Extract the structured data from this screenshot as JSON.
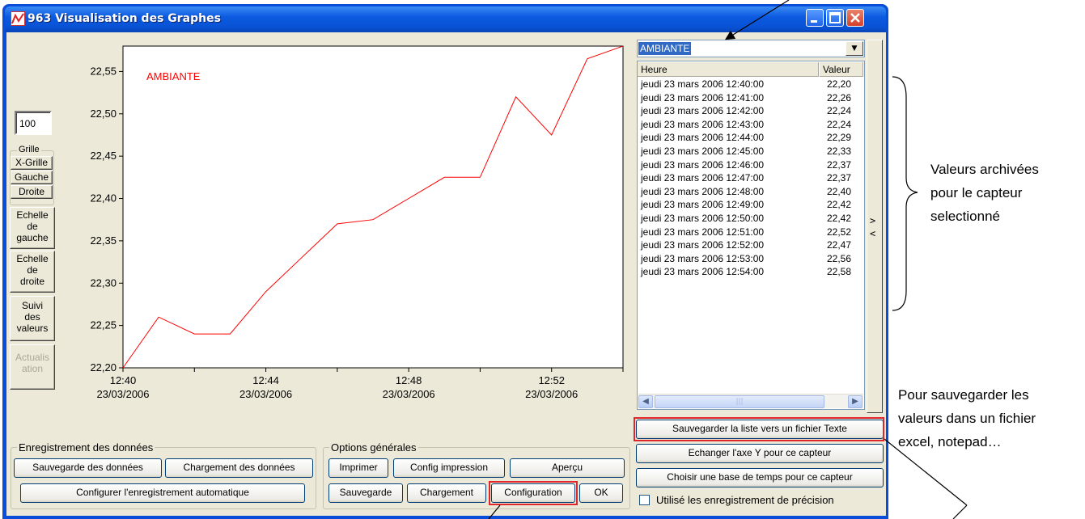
{
  "window": {
    "title": "963 Visualisation des Graphes"
  },
  "left_panel": {
    "scale_value": "100",
    "grille_group": "Grille",
    "buttons": [
      "X-Grille",
      "Gauche",
      "Droite"
    ],
    "echelle_gauche": [
      "Echelle",
      "de",
      "gauche"
    ],
    "echelle_droite": [
      "Echelle",
      "de",
      "droite"
    ],
    "suivi": [
      "Suivi",
      "des",
      "valeurs"
    ],
    "actualisation": [
      "Actualis",
      "ation"
    ]
  },
  "chart_data": {
    "type": "line",
    "series": [
      {
        "name": "AMBIANTE",
        "color": "#ff0000",
        "x": [
          "12:40",
          "12:41",
          "12:42",
          "12:43",
          "12:44",
          "12:45",
          "12:46",
          "12:47",
          "12:48",
          "12:49",
          "12:50",
          "12:51",
          "12:52",
          "12:53",
          "12:54"
        ],
        "values": [
          22.2,
          22.26,
          22.24,
          22.24,
          22.29,
          22.33,
          22.37,
          22.375,
          22.4,
          22.425,
          22.425,
          22.52,
          22.475,
          22.565,
          22.58
        ]
      }
    ],
    "ylim": [
      22.2,
      22.58
    ],
    "y_ticks": [
      "22,20",
      "22,25",
      "22,30",
      "22,35",
      "22,40",
      "22,45",
      "22,50",
      "22,55"
    ],
    "x_ticks": [
      {
        "time": "12:40",
        "date": "23/03/2006"
      },
      {
        "time": "12:44",
        "date": "23/03/2006"
      },
      {
        "time": "12:48",
        "date": "23/03/2006"
      },
      {
        "time": "12:52",
        "date": "23/03/2006"
      }
    ],
    "legend_label": "AMBIANTE",
    "grid": false
  },
  "sensor_select": {
    "selected": "AMBIANTE"
  },
  "value_list": {
    "columns": [
      "Heure",
      "Valeur"
    ],
    "rows": [
      [
        "jeudi 23 mars 2006 12:40:00",
        "22,20"
      ],
      [
        "jeudi 23 mars 2006 12:41:00",
        "22,26"
      ],
      [
        "jeudi 23 mars 2006 12:42:00",
        "22,24"
      ],
      [
        "jeudi 23 mars 2006 12:43:00",
        "22,24"
      ],
      [
        "jeudi 23 mars 2006 12:44:00",
        "22,29"
      ],
      [
        "jeudi 23 mars 2006 12:45:00",
        "22,33"
      ],
      [
        "jeudi 23 mars 2006 12:46:00",
        "22,37"
      ],
      [
        "jeudi 23 mars 2006 12:47:00",
        "22,37"
      ],
      [
        "jeudi 23 mars 2006 12:48:00",
        "22,40"
      ],
      [
        "jeudi 23 mars 2006 12:49:00",
        "22,42"
      ],
      [
        "jeudi 23 mars 2006 12:50:00",
        "22,42"
      ],
      [
        "jeudi 23 mars 2006 12:51:00",
        "22,52"
      ],
      [
        "jeudi 23 mars 2006 12:52:00",
        "22,47"
      ],
      [
        "jeudi 23 mars 2006 12:53:00",
        "22,56"
      ],
      [
        "jeudi 23 mars 2006 12:54:00",
        "22,58"
      ]
    ],
    "collapse_top": ">",
    "collapse_bottom": "<"
  },
  "right_buttons": {
    "save_list": "Sauvegarder la liste vers un fichier Texte",
    "swap_axis": "Echanger l'axe Y pour ce capteur",
    "time_base": "Choisir une base de temps pour ce capteur",
    "precision_checkbox": "Utilisé les enregistrement de précision"
  },
  "data_recording": {
    "group": "Enregistrement des données",
    "save": "Sauvegarde des données",
    "load": "Chargement des données",
    "auto": "Configurer l'enregistrement automatique"
  },
  "general_options": {
    "group": "Options générales",
    "print": "Imprimer",
    "print_config": "Config impression",
    "preview": "Aperçu",
    "save": "Sauvegarde",
    "load": "Chargement",
    "configuration": "Configuration",
    "ok": "OK"
  },
  "annotations": {
    "archived": [
      "Valeurs archivées",
      "pour le capteur",
      "selectionné"
    ],
    "save_note": [
      "Pour sauvegarder les",
      "valeurs dans un fichier",
      "excel, notepad…"
    ]
  }
}
